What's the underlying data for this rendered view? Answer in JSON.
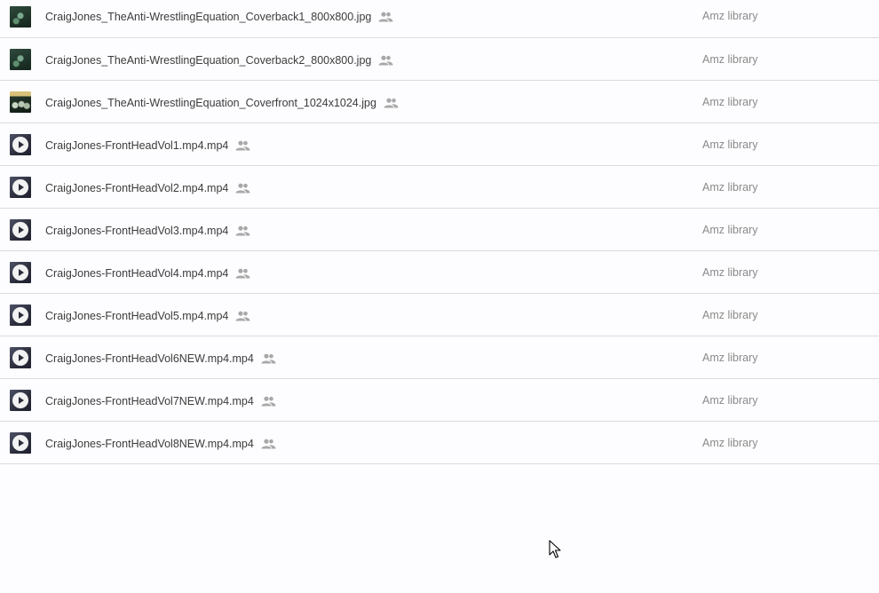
{
  "files": [
    {
      "name": "CraigJones_TheAnti-WrestlingEquation_Coverback1_800x800.jpg",
      "owner": "Amz library",
      "type": "image",
      "shared_icon": "people-icon"
    },
    {
      "name": "CraigJones_TheAnti-WrestlingEquation_Coverback2_800x800.jpg",
      "owner": "Amz library",
      "type": "image",
      "shared_icon": "people-icon"
    },
    {
      "name": "CraigJones_TheAnti-WrestlingEquation_Coverfront_1024x1024.jpg",
      "owner": "Amz library",
      "type": "cover",
      "shared_icon": "people-icon"
    },
    {
      "name": "CraigJones-FrontHeadVol1.mp4.mp4",
      "owner": "Amz library",
      "type": "video",
      "shared_icon": "people-icon"
    },
    {
      "name": "CraigJones-FrontHeadVol2.mp4.mp4",
      "owner": "Amz library",
      "type": "video",
      "shared_icon": "people-icon"
    },
    {
      "name": "CraigJones-FrontHeadVol3.mp4.mp4",
      "owner": "Amz library",
      "type": "video",
      "shared_icon": "people-icon"
    },
    {
      "name": "CraigJones-FrontHeadVol4.mp4.mp4",
      "owner": "Amz library",
      "type": "video",
      "shared_icon": "people-icon"
    },
    {
      "name": "CraigJones-FrontHeadVol5.mp4.mp4",
      "owner": "Amz library",
      "type": "video",
      "shared_icon": "people-icon"
    },
    {
      "name": "CraigJones-FrontHeadVol6NEW.mp4.mp4",
      "owner": "Amz library",
      "type": "video",
      "shared_icon": "people-icon"
    },
    {
      "name": "CraigJones-FrontHeadVol7NEW.mp4.mp4",
      "owner": "Amz library",
      "type": "video",
      "shared_icon": "people-icon"
    },
    {
      "name": "CraigJones-FrontHeadVol8NEW.mp4.mp4",
      "owner": "Amz library",
      "type": "video",
      "shared_icon": "people-icon"
    }
  ],
  "colors": {
    "background": "#fdfcfe",
    "divider": "#dcdcdc",
    "file_name_text": "#3c3c3c",
    "owner_text": "#8a8a8a",
    "shared_icon": "#a8a8a8"
  }
}
